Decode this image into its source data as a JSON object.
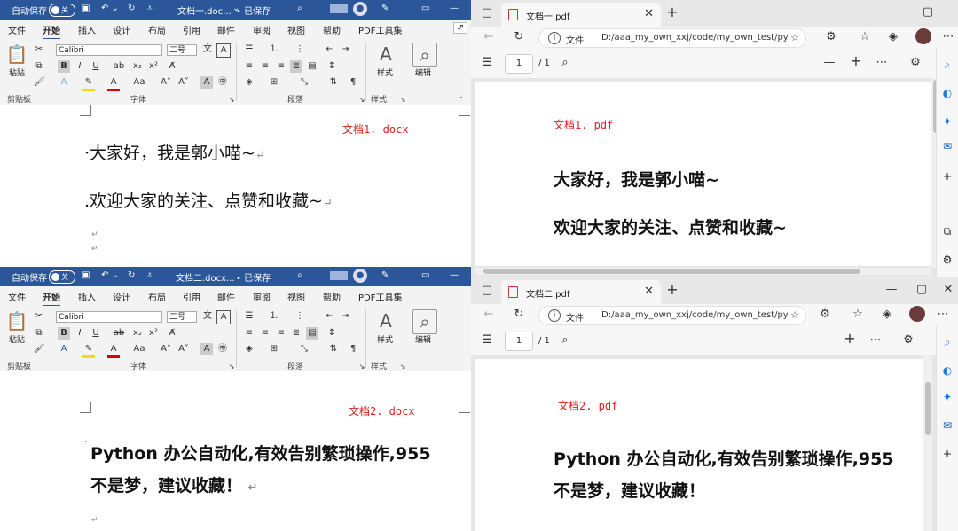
{
  "word_top": {
    "autosave_label": "自动保存",
    "autosave_state": "关",
    "filename": "文档一.doc...",
    "saved_status": "• 已保存",
    "menu": [
      "文件",
      "开始",
      "插入",
      "设计",
      "布局",
      "引用",
      "邮件",
      "审阅",
      "视图",
      "帮助",
      "PDF工具集"
    ],
    "font_name": "Calibri",
    "font_size": "二号",
    "groups": [
      "剪贴板",
      "字体",
      "段落",
      "样式"
    ],
    "paste": "粘贴",
    "styles": "样式",
    "edit": "编辑",
    "doc_label": "文档1. docx",
    "lines": [
      "大家好，我是郭小喵~",
      "欢迎大家的关注、点赞和收藏~"
    ],
    "para_mark": "↵"
  },
  "word_bottom": {
    "autosave_label": "自动保存",
    "autosave_state": "关",
    "filename": "文档二.docx...",
    "saved_status": "• 已保存",
    "menu": [
      "文件",
      "开始",
      "插入",
      "设计",
      "布局",
      "引用",
      "邮件",
      "审阅",
      "视图",
      "帮助",
      "PDF工具集"
    ],
    "font_name": "Calibri",
    "font_size": "二号",
    "groups": [
      "剪贴板",
      "字体",
      "段落",
      "样式"
    ],
    "paste": "粘贴",
    "styles": "样式",
    "edit": "编辑",
    "doc_label": "文档2. docx",
    "lines": [
      "Python 办公自动化,有效告别繁琐操作,955",
      "不是梦，建议收藏！"
    ],
    "para_mark": "↵"
  },
  "edge_top": {
    "tab_title": "文档一.pdf",
    "addr_label": "文件",
    "url": "D:/aaa_my_own_xxj/code/my_own_test/pyt...",
    "page_current": "1",
    "page_total": "/ 1",
    "doc_label": "文档1. pdf",
    "lines": [
      "大家好，我是郭小喵~",
      "欢迎大家的关注、点赞和收藏~"
    ]
  },
  "edge_bottom": {
    "tab_title": "文档二.pdf",
    "addr_label": "文件",
    "url": "D:/aaa_my_own_xxj/code/my_own_test/py...",
    "page_current": "1",
    "page_total": "/ 1",
    "doc_label": "文档2. pdf",
    "lines": [
      "Python 办公自动化,有效告别繁琐操作,955",
      "不是梦，建议收藏！"
    ]
  },
  "colors": {
    "word_blue": "#2b579a",
    "label_red": "#e02020",
    "pdf_red": "#d13438"
  }
}
